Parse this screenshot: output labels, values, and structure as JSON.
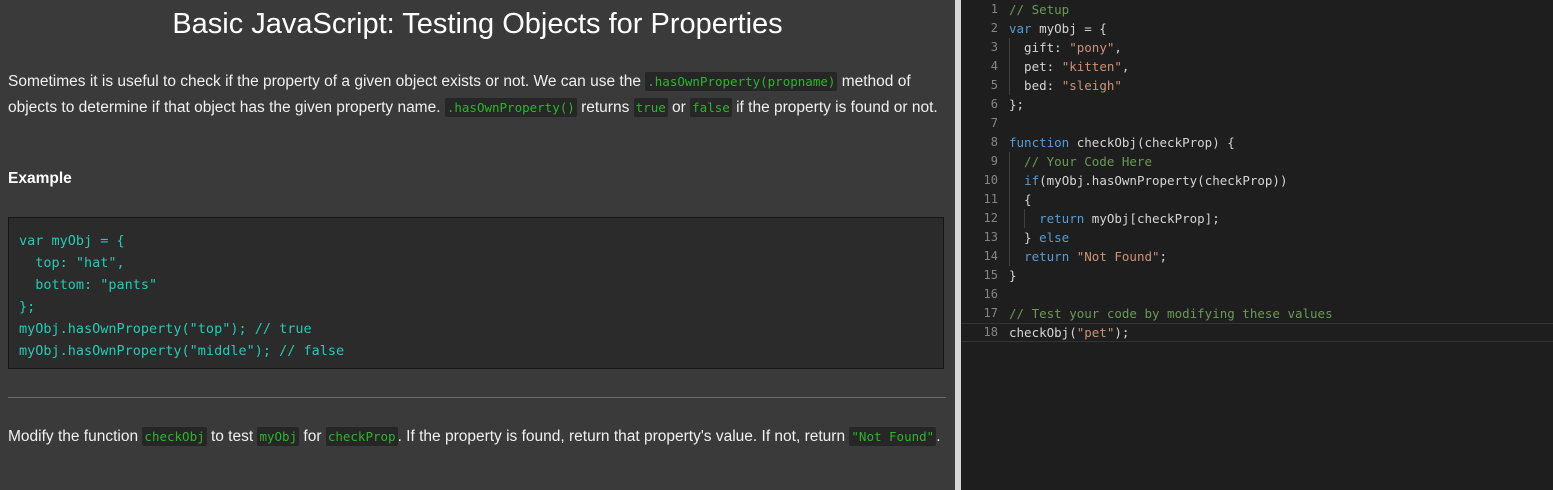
{
  "challenge": {
    "title": "Basic JavaScript: Testing Objects for Properties",
    "intro": {
      "t1": "Sometimes it is useful to check if the property of a given object exists or not. We can use the ",
      "c1": ".hasOwnProperty(propname)",
      "t2": " method of objects to determine if that object has the given property name. ",
      "c2": ".hasOwnProperty()",
      "t3": " returns ",
      "c3": "true",
      "t4": " or ",
      "c4": "false",
      "t5": " if the property is found or not."
    },
    "example_label": "Example",
    "example_code": "var myObj = {\n  top: \"hat\",\n  bottom: \"pants\"\n};\nmyObj.hasOwnProperty(\"top\"); // true\nmyObj.hasOwnProperty(\"middle\"); // false",
    "instructions": {
      "t1": "Modify the function ",
      "c1": "checkObj",
      "t2": " to test ",
      "c2": "myObj",
      "t3": " for ",
      "c3": "checkProp",
      "t4": ". If the property is found, return that property's value. If not, return ",
      "c4": "\"Not Found\"",
      "t5": "."
    }
  },
  "editor": {
    "lines": [
      {
        "n": "1",
        "segs": [
          {
            "t": "// Setup",
            "c": "cm"
          }
        ]
      },
      {
        "n": "2",
        "segs": [
          {
            "t": "var",
            "c": "kw"
          },
          {
            "t": " myObj = {",
            "c": "tx"
          }
        ]
      },
      {
        "n": "3",
        "segs": [
          {
            "t": "  gift: ",
            "c": "tx"
          },
          {
            "t": "\"pony\"",
            "c": "st"
          },
          {
            "t": ",",
            "c": "tx"
          }
        ]
      },
      {
        "n": "4",
        "segs": [
          {
            "t": "  pet: ",
            "c": "tx"
          },
          {
            "t": "\"kitten\"",
            "c": "st"
          },
          {
            "t": ",",
            "c": "tx"
          }
        ]
      },
      {
        "n": "5",
        "segs": [
          {
            "t": "  bed: ",
            "c": "tx"
          },
          {
            "t": "\"sleigh\"",
            "c": "st"
          }
        ]
      },
      {
        "n": "6",
        "segs": [
          {
            "t": "};",
            "c": "tx"
          }
        ]
      },
      {
        "n": "7",
        "segs": []
      },
      {
        "n": "8",
        "segs": [
          {
            "t": "function",
            "c": "kw"
          },
          {
            "t": " checkObj(checkProp) {",
            "c": "tx"
          }
        ]
      },
      {
        "n": "9",
        "segs": [
          {
            "t": "  // Your Code Here",
            "c": "cm"
          }
        ]
      },
      {
        "n": "10",
        "segs": [
          {
            "t": "  ",
            "c": "tx"
          },
          {
            "t": "if",
            "c": "kw"
          },
          {
            "t": "(myObj.hasOwnProperty(checkProp))",
            "c": "tx"
          }
        ]
      },
      {
        "n": "11",
        "segs": [
          {
            "t": "  {",
            "c": "tx"
          }
        ]
      },
      {
        "n": "12",
        "segs": [
          {
            "t": "    ",
            "c": "tx"
          },
          {
            "t": "return",
            "c": "kw"
          },
          {
            "t": " myObj[checkProp];",
            "c": "tx"
          }
        ]
      },
      {
        "n": "13",
        "segs": [
          {
            "t": "  } ",
            "c": "tx"
          },
          {
            "t": "else",
            "c": "kw"
          }
        ]
      },
      {
        "n": "14",
        "segs": [
          {
            "t": "  ",
            "c": "tx"
          },
          {
            "t": "return",
            "c": "kw"
          },
          {
            "t": " ",
            "c": "tx"
          },
          {
            "t": "\"Not Found\"",
            "c": "st"
          },
          {
            "t": ";",
            "c": "tx"
          }
        ]
      },
      {
        "n": "15",
        "segs": [
          {
            "t": "}",
            "c": "tx"
          }
        ]
      },
      {
        "n": "16",
        "segs": []
      },
      {
        "n": "17",
        "segs": [
          {
            "t": "// Test your code by modifying these values",
            "c": "cm"
          }
        ]
      },
      {
        "n": "18",
        "segs": [
          {
            "t": "checkObj(",
            "c": "tx"
          },
          {
            "t": "\"pet\"",
            "c": "st"
          },
          {
            "t": ");",
            "c": "tx"
          }
        ]
      }
    ],
    "active_line": "18"
  }
}
